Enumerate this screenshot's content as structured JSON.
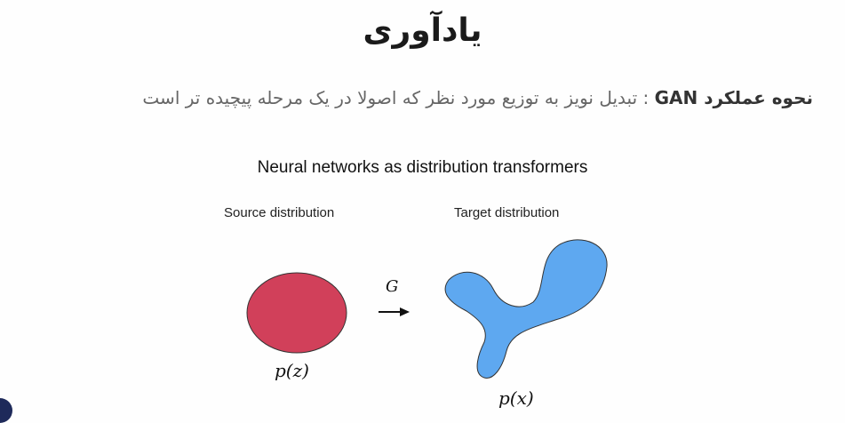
{
  "slide": {
    "title": "یادآوری",
    "subtitle_bold": "نحوه عملکرد GAN",
    "subtitle_rest": " : تبدیل نویز به توزیع مورد نظر که اصولا در یک مرحله پیچیده تر است"
  },
  "figure": {
    "title": "Neural networks as distribution transformers",
    "source_label": "Source distribution",
    "target_label": "Target distribution",
    "generator_label": "G",
    "source_math": "p(z)",
    "target_math": "p(x)",
    "colors": {
      "source": "#d1405a",
      "target": "#5ea8f0",
      "outline": "#333333"
    }
  }
}
